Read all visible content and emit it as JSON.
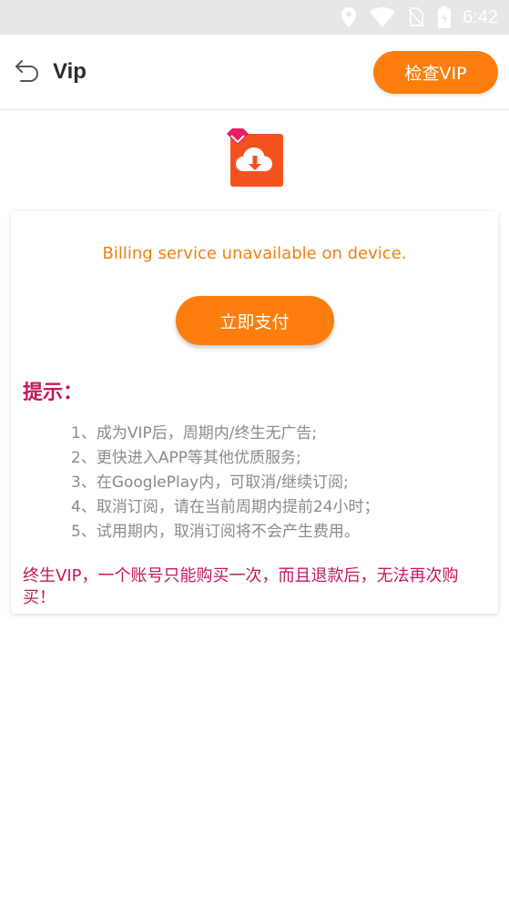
{
  "status_bar": {
    "time": "6:42",
    "icons": [
      "location-icon",
      "wifi-icon",
      "no-sim-icon",
      "battery-icon"
    ]
  },
  "app_bar": {
    "title": "Vip",
    "check_button_label": "检查VIP"
  },
  "logo": {
    "icon": "cloud-download-app-icon"
  },
  "card": {
    "billing_message": "Billing service unavailable on device.",
    "pay_button_label": "立即支付",
    "tips_title": "提示：",
    "tips": [
      "1、成为VIP后，周期内/终生无广告;",
      "2、更快进入APP等其他优质服务;",
      "3、在GooglePlay内，可取消/继续订阅;",
      "4、取消订阅，请在当前周期内提前24小时；",
      "5、试用期内，取消订阅将不会产生费用。"
    ],
    "warning": "终生VIP，一个账号只能购买一次，而且退款后，无法再次购买！"
  },
  "colors": {
    "accent": "#fd7e0e",
    "billing_text": "#f07f12",
    "tips_title": "#c2185b",
    "status_bar_bg": "#e6e6e6"
  }
}
